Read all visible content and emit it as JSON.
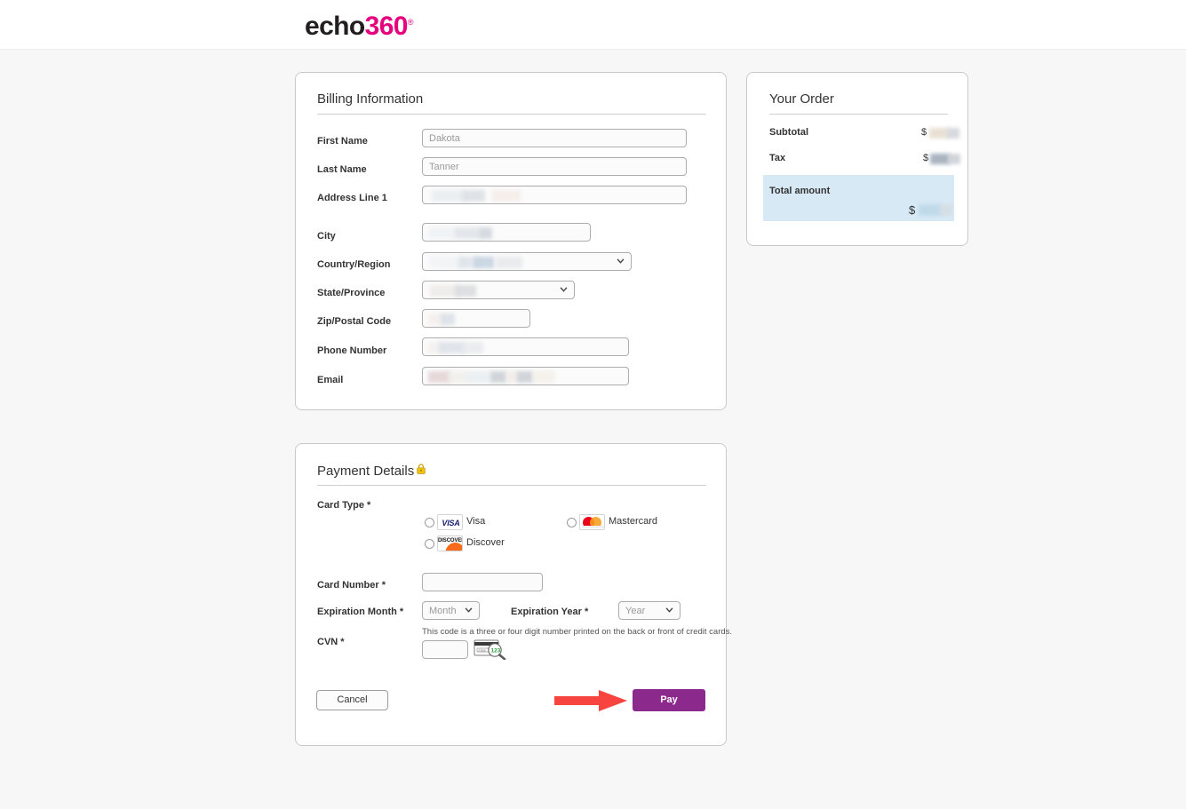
{
  "brand": {
    "logo_primary": "echo",
    "logo_accent": "360",
    "logo_registered": "®",
    "accent_color": "#e6007e",
    "dark_color": "#231f20"
  },
  "billing": {
    "title": "Billing Information",
    "fields": [
      {
        "label": "First Name",
        "value": "Dakota",
        "redacted": false
      },
      {
        "label": "Last Name",
        "value": "Tanner",
        "redacted": false
      },
      {
        "label": "Address Line 1",
        "value": "",
        "redacted": true
      },
      {
        "label": "City",
        "value": "",
        "redacted": true
      },
      {
        "label": "Country/Region",
        "value": "",
        "redacted": true
      },
      {
        "label": "State/Province",
        "value": "",
        "redacted": true
      },
      {
        "label": "Zip/Postal Code",
        "value": "",
        "redacted": true
      },
      {
        "label": "Phone Number",
        "value": "",
        "redacted": true
      },
      {
        "label": "Email",
        "value": "",
        "redacted": true
      }
    ]
  },
  "order": {
    "title": "Your Order",
    "subtotal_label": "Subtotal",
    "subtotal_value": "$",
    "tax_label": "Tax",
    "tax_value": "$",
    "total_label": "Total amount",
    "total_value": "$",
    "highlight_color": "#d7e9f5"
  },
  "payment": {
    "title": "Payment Details",
    "lock_icon": "lock-icon",
    "card_type_label": "Card Type *",
    "card_types": [
      {
        "id": "visa",
        "label": "Visa",
        "icon": "visa-logo-icon",
        "selected": false
      },
      {
        "id": "mastercard",
        "label": "Mastercard",
        "icon": "mastercard-logo-icon",
        "selected": false
      },
      {
        "id": "discover",
        "label": "Discover",
        "icon": "discover-logo-icon",
        "selected": false
      }
    ],
    "card_number_label": "Card Number *",
    "card_number_value": "",
    "expiration_month_label": "Expiration Month *",
    "expiration_month_value": "Month",
    "expiration_year_label": "Expiration Year *",
    "expiration_year_value": "Year",
    "cvn_label": "CVN *",
    "cvn_value": "",
    "cvn_help": "This code is a three or four digit number printed on the back or front of credit cards.",
    "cvn_image_icon": "cvn-card-magnifier-icon",
    "cvn_image_digits": "123"
  },
  "actions": {
    "cancel_label": "Cancel",
    "pay_label": "Pay",
    "pay_color": "#8b2a8c"
  },
  "annotation": {
    "arrow_icon": "red-arrow-pointing-right",
    "arrow_color": "#f8443f",
    "points_to": "Pay"
  }
}
